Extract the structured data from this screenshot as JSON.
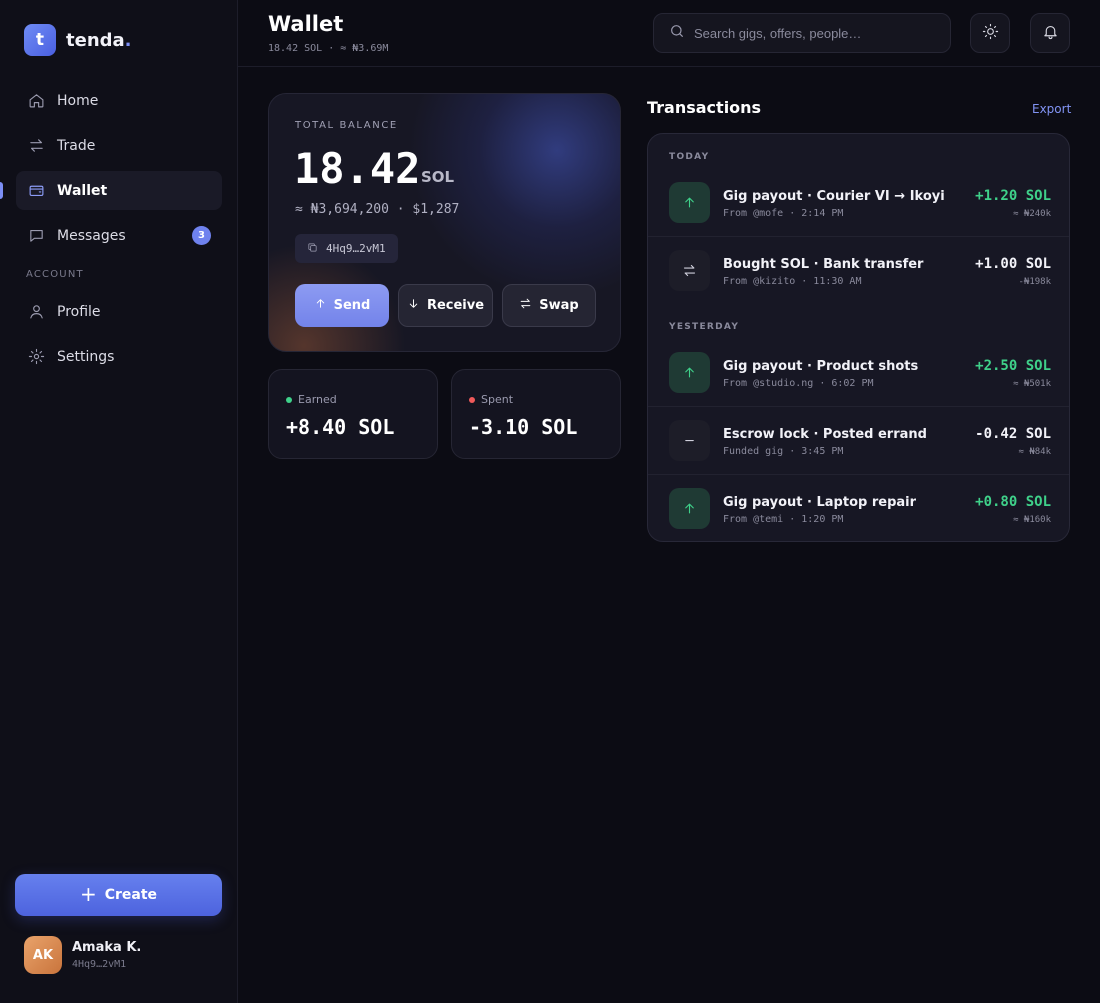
{
  "brand": {
    "logo_letter": "t",
    "name": "tenda",
    "dot": "."
  },
  "sidebar": {
    "items": [
      {
        "label": "Home",
        "icon": "home-icon"
      },
      {
        "label": "Trade",
        "icon": "arrows-swap-icon"
      },
      {
        "label": "Wallet",
        "icon": "wallet-icon",
        "active": true
      },
      {
        "label": "Messages",
        "icon": "message-icon",
        "badge": "3"
      }
    ],
    "section_label": "ACCOUNT",
    "account_items": [
      {
        "label": "Profile",
        "icon": "user-icon"
      },
      {
        "label": "Settings",
        "icon": "gear-icon"
      }
    ],
    "create_label": "Create",
    "user": {
      "initials": "AK",
      "name": "Amaka K.",
      "address": "4Hq9…2vM1"
    }
  },
  "header": {
    "title": "Wallet",
    "subtitle": "18.42 SOL · ≈ ₦3.69M",
    "search_placeholder": "Search gigs, offers, people…"
  },
  "balance": {
    "label": "TOTAL BALANCE",
    "amount": "18.42",
    "unit": "SOL",
    "fiat": "≈ ₦3,694,200 · $1,287",
    "address": "4Hq9…2vM1",
    "actions": {
      "send": "Send",
      "receive": "Receive",
      "swap": "Swap"
    }
  },
  "stats": {
    "earned": {
      "label": "Earned",
      "value": "+8.40 SOL",
      "color": "#3fd18a"
    },
    "spent": {
      "label": "Spent",
      "value": "-3.10 SOL",
      "color": "#f05a5a"
    }
  },
  "transactions": {
    "title": "Transactions",
    "export_label": "Export",
    "groups": [
      {
        "label": "TODAY"
      },
      {
        "label": "YESTERDAY"
      }
    ],
    "items": [
      {
        "name": "Gig payout · Courier VI → Ikoyi",
        "meta": "From @mofe · 2:14 PM",
        "amount": "+1.20 SOL",
        "fiat": "≈ ₦240k",
        "icon": "arrow-up-icon"
      },
      {
        "name": "Bought SOL · Bank transfer",
        "meta": "From @kizito · 11:30 AM",
        "amount": "+1.00 SOL",
        "fiat": "-₦198k",
        "icon": "swap-icon"
      },
      {
        "name": "Gig payout · Product shots",
        "meta": "From @studio.ng · 6:02 PM",
        "amount": "+2.50 SOL",
        "fiat": "≈ ₦501k",
        "icon": "arrow-up-icon"
      },
      {
        "name": "Escrow lock · Posted errand",
        "meta": "Funded gig · 3:45 PM",
        "amount": "-0.42 SOL",
        "fiat": "≈ ₦84k",
        "icon": "minus-icon"
      },
      {
        "name": "Gig payout · Laptop repair",
        "meta": "From @temi · 1:20 PM",
        "amount": "+0.80 SOL",
        "fiat": "≈ ₦160k",
        "icon": "arrow-up-icon"
      }
    ]
  },
  "colors": {
    "accent": "#7c8ef5",
    "positive": "#3fd18a",
    "negative": "#f05a5a",
    "background": "#0c0c14"
  }
}
